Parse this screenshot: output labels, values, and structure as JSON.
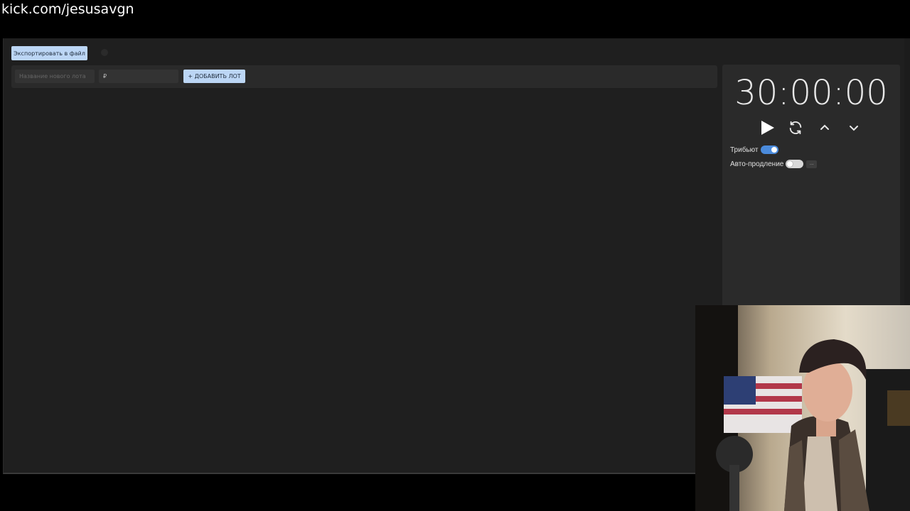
{
  "overlay": {
    "stream_url": "kick.com/jesusavgn"
  },
  "toolbar": {
    "export_label": "Экспортировать в файл"
  },
  "lot_form": {
    "name_placeholder": "Название нового лота",
    "price_value": "₽",
    "add_label": "+ ДОБАВИТЬ ЛОТ"
  },
  "timer": {
    "display": "30:00:00",
    "controls": [
      "play-icon",
      "refresh-icon",
      "chevron-up-icon",
      "chevron-down-icon"
    ],
    "tribute": {
      "label": "Трибьют",
      "enabled": true
    },
    "auto_extend": {
      "label": "Авто-продление",
      "enabled": false,
      "more_label": "..."
    }
  },
  "colors": {
    "accent": "#4b8bdc",
    "button_bg": "#bcd6f5",
    "app_bg": "#1f1f1f",
    "panel_bg": "#2a2a2a"
  }
}
